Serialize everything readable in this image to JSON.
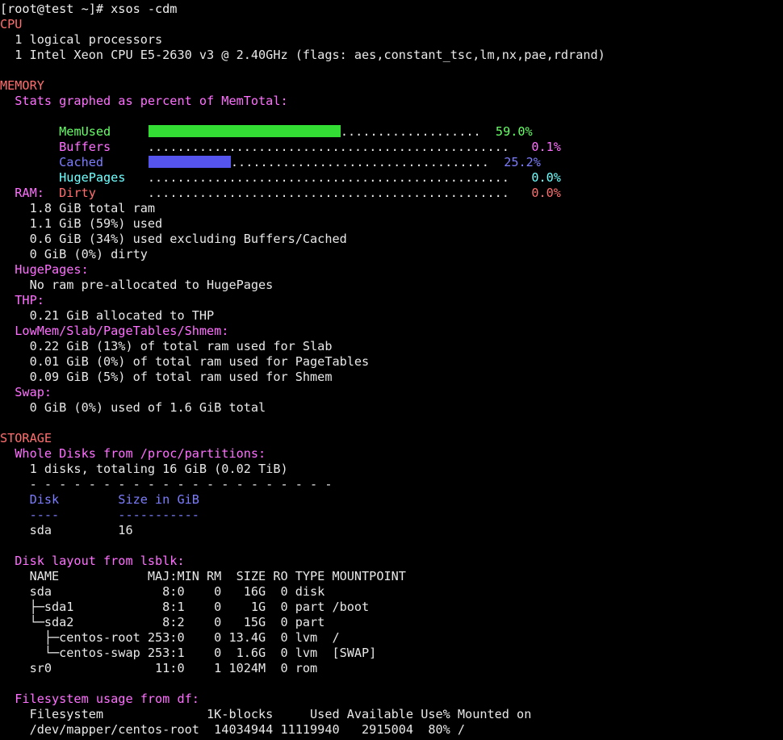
{
  "prompt": "[root@test ~]# xsos -cdm",
  "cpu": {
    "heading": "CPU",
    "line1": "  1 logical processors",
    "line2": "  1 Intel Xeon CPU E5-2630 v3 @ 2.40GHz (flags: aes,constant_tsc,lm,nx,pae,rdrand)"
  },
  "memory": {
    "heading": "MEMORY",
    "stats_heading": "  Stats graphed as percent of MemTotal:",
    "graph": [
      {
        "name": "MemUsed",
        "percent": 59.0,
        "percent_label": "59.0%",
        "color": "#66ff66"
      },
      {
        "name": "Buffers",
        "percent": 0.1,
        "percent_label": "0.1%",
        "color": "#ff6fff"
      },
      {
        "name": "Cached",
        "percent": 25.2,
        "percent_label": "25.2%",
        "color": "#7d7dff"
      },
      {
        "name": "HugePages",
        "percent": 0.0,
        "percent_label": "0.0%",
        "color": "#6fffff"
      },
      {
        "name": "Dirty",
        "percent": 0.0,
        "percent_label": "0.0%",
        "color": "#ff6f6f"
      }
    ],
    "ram_heading": "  RAM:",
    "ram_lines": [
      "    1.8 GiB total ram",
      "    1.1 GiB (59%) used",
      "    0.6 GiB (34%) used excluding Buffers/Cached",
      "    0 GiB (0%) dirty"
    ],
    "hugepages_heading": "  HugePages:",
    "hugepages_line": "    No ram pre-allocated to HugePages",
    "thp_heading": "  THP:",
    "thp_line": "    0.21 GiB allocated to THP",
    "lowmem_heading": "  LowMem/Slab/PageTables/Shmem:",
    "lowmem_lines": [
      "    0.22 GiB (13%) of total ram used for Slab",
      "    0.01 GiB (0%) of total ram used for PageTables",
      "    0.09 GiB (5%) of total ram used for Shmem"
    ],
    "swap_heading": "  Swap:",
    "swap_line": "    0 GiB (0%) used of 1.6 GiB total"
  },
  "storage": {
    "heading": "STORAGE",
    "whole_disks_heading": "  Whole Disks from /proc/partitions:",
    "whole_disks_line": "    1 disks, totaling 16 GiB (0.02 TiB)",
    "separator": "    - - - - - - - - - - - - - - - - - - - - -",
    "disk_table": {
      "header": "    Disk        Size in GiB",
      "underline": "    ----        -----------",
      "rows": [
        "    sda         16"
      ]
    },
    "lsblk_heading": "  Disk layout from lsblk:",
    "lsblk_lines": [
      "    NAME            MAJ:MIN RM  SIZE RO TYPE MOUNTPOINT",
      "    sda               8:0    0   16G  0 disk",
      "    ├─sda1            8:1    0    1G  0 part /boot",
      "    └─sda2            8:2    0   15G  0 part",
      "      ├─centos-root 253:0    0 13.4G  0 lvm  /",
      "      └─centos-swap 253:1    0  1.6G  0 lvm  [SWAP]",
      "    sr0              11:0    1 1024M  0 rom"
    ],
    "df_heading": "  Filesystem usage from df:",
    "df_lines": [
      "    Filesystem              1K-blocks     Used Available Use% Mounted on",
      "    /dev/mapper/centos-root  14034944 11119940   2915004  80% /"
    ]
  }
}
